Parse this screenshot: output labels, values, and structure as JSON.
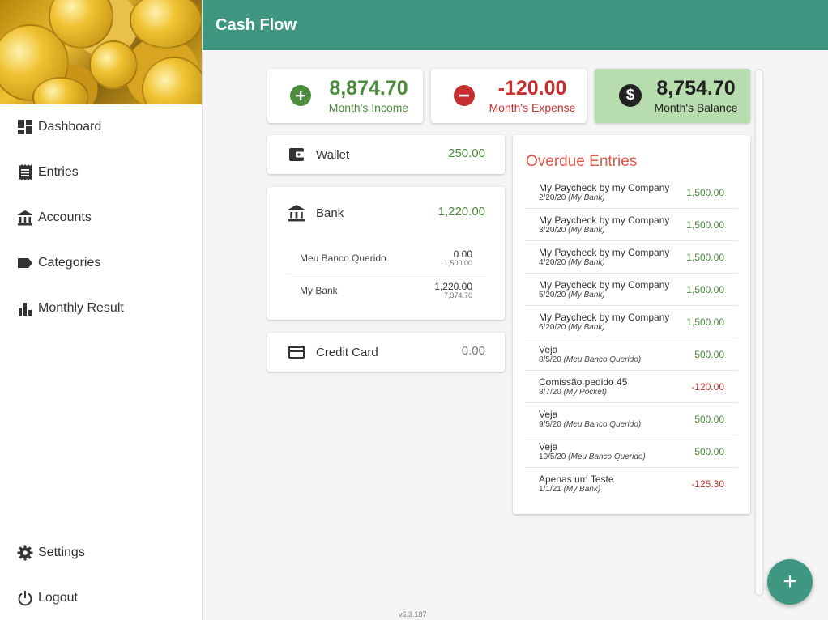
{
  "app": {
    "title": "Cash Flow",
    "version": "v6.3.187"
  },
  "sidebar": {
    "items": [
      {
        "label": "Dashboard",
        "icon": "dashboard-icon"
      },
      {
        "label": "Entries",
        "icon": "receipt-icon"
      },
      {
        "label": "Accounts",
        "icon": "bank-icon"
      },
      {
        "label": "Categories",
        "icon": "label-icon"
      },
      {
        "label": "Monthly Result",
        "icon": "bar-chart-icon"
      }
    ],
    "bottom": [
      {
        "label": "Settings",
        "icon": "gear-icon"
      },
      {
        "label": "Logout",
        "icon": "power-icon"
      }
    ]
  },
  "summary": {
    "income": {
      "value": "8,874.70",
      "label": "Month's Income"
    },
    "expense": {
      "value": "-120.00",
      "label": "Month's Expense"
    },
    "balance": {
      "value": "8,754.70",
      "label": "Month's Balance"
    }
  },
  "accounts": {
    "wallet": {
      "name": "Wallet",
      "total": "250.00"
    },
    "bank": {
      "name": "Bank",
      "total": "1,220.00",
      "sub": [
        {
          "name": "Meu Banco Querido",
          "current": "0.00",
          "forecast": "1,500.00"
        },
        {
          "name": "My Bank",
          "current": "1,220.00",
          "forecast": "7,374.70"
        }
      ]
    },
    "credit_card": {
      "name": "Credit Card",
      "total": "0.00"
    }
  },
  "overdue": {
    "title": "Overdue Entries",
    "entries": [
      {
        "desc": "My Paycheck by my Company",
        "date": "2/20/20",
        "account": "(My Bank)",
        "amount": "1,500.00"
      },
      {
        "desc": "My Paycheck by my Company",
        "date": "3/20/20",
        "account": "(My Bank)",
        "amount": "1,500.00"
      },
      {
        "desc": "My Paycheck by my Company",
        "date": "4/20/20",
        "account": "(My Bank)",
        "amount": "1,500.00"
      },
      {
        "desc": "My Paycheck by my Company",
        "date": "5/20/20",
        "account": "(My Bank)",
        "amount": "1,500.00"
      },
      {
        "desc": "My Paycheck by my Company",
        "date": "6/20/20",
        "account": "(My Bank)",
        "amount": "1,500.00"
      },
      {
        "desc": "Veja",
        "date": "8/5/20",
        "account": "(Meu Banco Querido)",
        "amount": "500.00"
      },
      {
        "desc": "Comissão pedido 45",
        "date": "8/7/20",
        "account": "(My Pocket)",
        "amount": "-120.00"
      },
      {
        "desc": "Veja",
        "date": "9/5/20",
        "account": "(Meu Banco Querido)",
        "amount": "500.00"
      },
      {
        "desc": "Veja",
        "date": "10/5/20",
        "account": "(Meu Banco Querido)",
        "amount": "500.00"
      },
      {
        "desc": "Apenas um Teste",
        "date": "1/1/21",
        "account": "(My Bank)",
        "amount": "-125.30"
      }
    ]
  },
  "fab": {
    "label": "+"
  },
  "colors": {
    "primary": "#3f9782",
    "income": "#4c8c3d",
    "expense": "#c62f2f",
    "balance_bg": "#b7dcae"
  }
}
